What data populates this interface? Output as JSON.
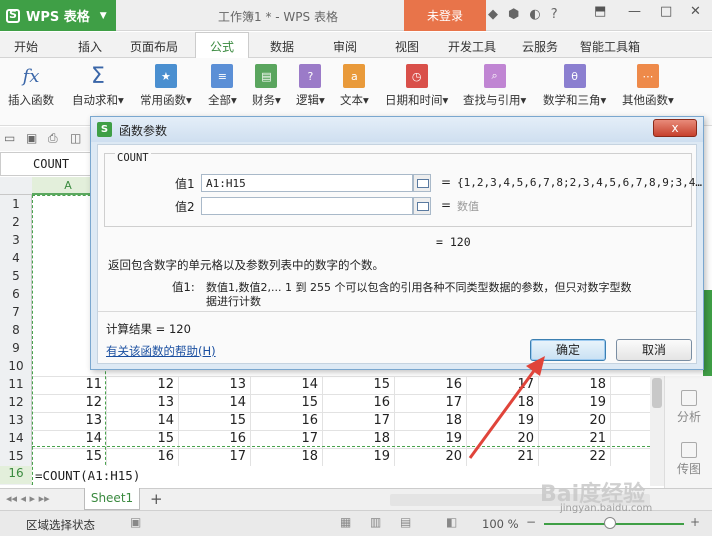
{
  "titlebar": {
    "app_name": "WPS 表格",
    "doc_title": "工作簿1 * - WPS 表格",
    "login": "未登录"
  },
  "tabs": [
    "开始",
    "插入",
    "页面布局",
    "公式",
    "数据",
    "审阅",
    "视图",
    "开发工具",
    "云服务",
    "智能工具箱"
  ],
  "active_tab": "公式",
  "ribbon": [
    {
      "label": "插入函数",
      "icon": "fx-icon"
    },
    {
      "label": "自动求和",
      "icon": "sigma-icon"
    },
    {
      "label": "常用函数",
      "icon": "star-icon"
    },
    {
      "label": "全部",
      "icon": "list-icon"
    },
    {
      "label": "财务",
      "icon": "finance-icon"
    },
    {
      "label": "逻辑",
      "icon": "question-icon"
    },
    {
      "label": "文本",
      "icon": "text-icon"
    },
    {
      "label": "日期和时间",
      "icon": "clock-icon"
    },
    {
      "label": "查找与引用",
      "icon": "search-icon"
    },
    {
      "label": "数学和三角",
      "icon": "theta-icon"
    },
    {
      "label": "其他函数",
      "icon": "more-icon"
    }
  ],
  "namebox": "COUNT",
  "col_a_header": "A",
  "row_numbers": [
    "1",
    "2",
    "3",
    "4",
    "5",
    "6",
    "7",
    "8",
    "9",
    "10",
    "11",
    "12",
    "13",
    "14",
    "15",
    "16"
  ],
  "cells": [
    [
      "11",
      "12",
      "13",
      "14",
      "15",
      "16",
      "17",
      "18"
    ],
    [
      "12",
      "13",
      "14",
      "15",
      "16",
      "17",
      "18",
      "19"
    ],
    [
      "13",
      "14",
      "15",
      "16",
      "17",
      "18",
      "19",
      "20"
    ],
    [
      "14",
      "15",
      "16",
      "17",
      "18",
      "19",
      "20",
      "21"
    ],
    [
      "15",
      "16",
      "17",
      "18",
      "19",
      "20",
      "21",
      "22"
    ]
  ],
  "row10_partial": [
    "7"
  ],
  "edit_formula": "=COUNT(A1:H15)",
  "sheet_tab": "Sheet1",
  "status": {
    "mode": "区域选择状态",
    "zoom": "100 %"
  },
  "side_panel": [
    "分析",
    "传图"
  ],
  "dialog": {
    "title": "函数参数",
    "fn_name": "COUNT",
    "arg1_label": "值1",
    "arg1_value": "A1:H15",
    "arg1_result": "{1,2,3,4,5,6,7,8;2,3,4,5,6,7,8,9;3,4…",
    "arg2_label": "值2",
    "arg2_value": "",
    "arg2_placeholder": "数值",
    "equals": "=",
    "total": "= 120",
    "description": "返回包含数字的单元格以及参数列表中的数字的个数。",
    "param_name": "值1:",
    "param_desc_line1": "数值1,数值2,... 1 到 255 个可以包含的引用各种不同类型数据的参数，但只对数字型数",
    "param_desc_line2": "据进行计数",
    "result_label": "计算结果 = 120",
    "help_link": "有关该函数的帮助(H)",
    "ok": "确定",
    "cancel": "取消",
    "close": "x"
  },
  "colors": {
    "brand_green": "#3f9f46",
    "login_orange": "#e8744a",
    "arrow_red": "#e0443a"
  },
  "watermark": "Bai度经验",
  "watermark_url": "jingyan.baidu.com"
}
